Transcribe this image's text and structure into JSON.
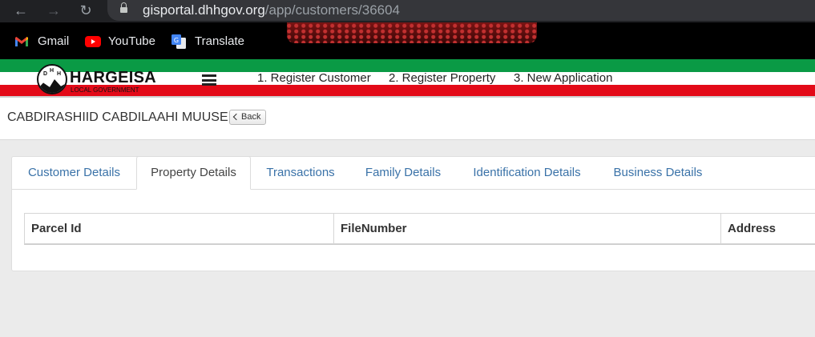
{
  "browser": {
    "url_domain": "gisportal.dhhgov.org",
    "url_path": "/app/customers/36604",
    "bookmarks": [
      {
        "label": "Gmail",
        "icon": "gmail-icon"
      },
      {
        "label": "YouTube",
        "icon": "youtube-icon"
      },
      {
        "label": "Translate",
        "icon": "google-translate-icon"
      }
    ]
  },
  "header": {
    "logo_title": "HARGEISA",
    "logo_subtitle": "LOCAL GOVERNMENT",
    "nav": [
      "1. Register Customer",
      "2. Register Property",
      "3. New Application"
    ],
    "colors": {
      "green": "#0a9a45",
      "red": "#e30a18"
    }
  },
  "page": {
    "customer_name": "CABDIRASHIID CABDILAAHI MUUSE",
    "back_label": "Back"
  },
  "tabs": [
    {
      "label": "Customer Details",
      "active": false
    },
    {
      "label": "Property Details",
      "active": true
    },
    {
      "label": "Transactions",
      "active": false
    },
    {
      "label": "Family Details",
      "active": false
    },
    {
      "label": "Identification Details",
      "active": false
    },
    {
      "label": "Business Details",
      "active": false
    }
  ],
  "table": {
    "columns": [
      "Parcel Id",
      "FileNumber",
      "Address"
    ],
    "rows": []
  }
}
